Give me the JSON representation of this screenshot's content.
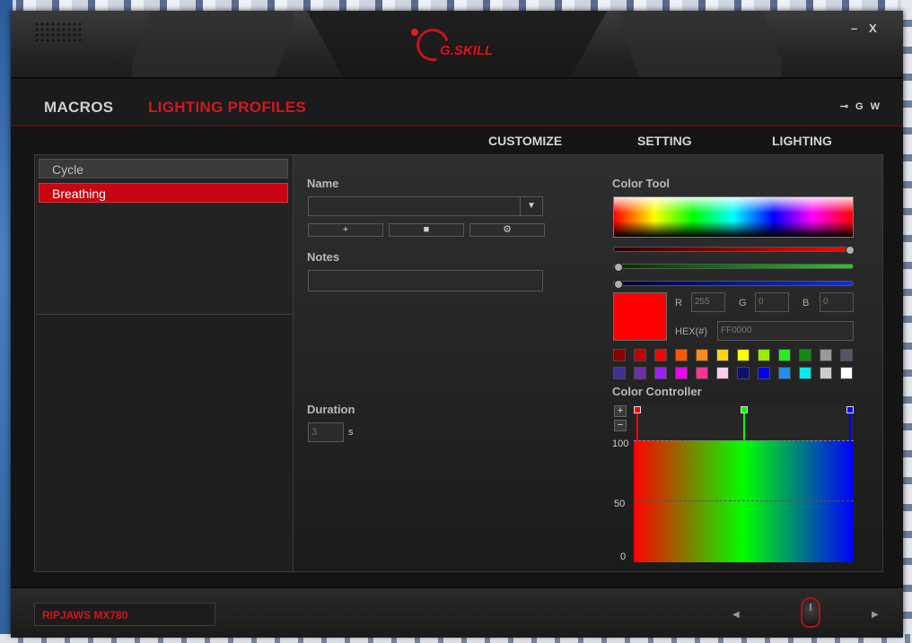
{
  "window": {
    "logo_text": "G.SKILL",
    "minimize": "–",
    "close": "X"
  },
  "nav": {
    "tabs": [
      "MACROS",
      "LIGHTING PROFILES"
    ],
    "active_tab": "LIGHTING PROFILES",
    "right_icons": [
      "usb-icon",
      "G",
      "W"
    ],
    "g_label": "G",
    "w_label": "W",
    "usb_glyph": "⊸"
  },
  "subnav": {
    "customize": "CUSTOMIZE",
    "setting": "SETTING",
    "lighting": "LIGHTING"
  },
  "effects": [
    {
      "label": "Cycle",
      "selected": false
    },
    {
      "label": "Breathing",
      "selected": true
    }
  ],
  "form": {
    "name_label": "Name",
    "name_value": "",
    "add_glyph": "+",
    "delete_glyph": "■",
    "settings_glyph": "⚙",
    "notes_label": "Notes",
    "notes_value": "",
    "duration_label": "Duration",
    "duration_placeholder": "3",
    "duration_unit": "s"
  },
  "color_tool": {
    "title": "Color Tool",
    "r_label": "R",
    "g_label": "G",
    "b_label": "B",
    "r_placeholder": "255",
    "g_placeholder": "0",
    "b_placeholder": "0",
    "hex_label": "HEX(#)",
    "hex_placeholder": "FF0000",
    "selected_color": "#ff0000",
    "slider_levels": {
      "r": 1.0,
      "g": 0.0,
      "b": 0.0
    },
    "palette": [
      "#8b0000",
      "#c00000",
      "#ff0000",
      "#ff5a00",
      "#ff8c1a",
      "#ffd21a",
      "#ffff00",
      "#99ee00",
      "#22ee22",
      "#118811",
      "#999999",
      "#555566",
      "#3f2f99",
      "#6f2fa8",
      "#9b1fff",
      "#ee00ee",
      "#ff3399",
      "#ffccee",
      "#101070",
      "#0000ee",
      "#1e8fee",
      "#00eeee",
      "#cccccc",
      "#ffffff"
    ]
  },
  "color_controller": {
    "title": "Color Controller",
    "plus": "+",
    "minus": "−",
    "y_ticks": [
      "100",
      "50",
      "0"
    ],
    "stops": [
      {
        "position": 0.0,
        "color": "#ff0000"
      },
      {
        "position": 0.5,
        "color": "#00ff00"
      },
      {
        "position": 1.0,
        "color": "#0000ff"
      }
    ]
  },
  "footer": {
    "device_name": "RIPJAWS MX780",
    "prev": "◀",
    "next": "▶"
  }
}
